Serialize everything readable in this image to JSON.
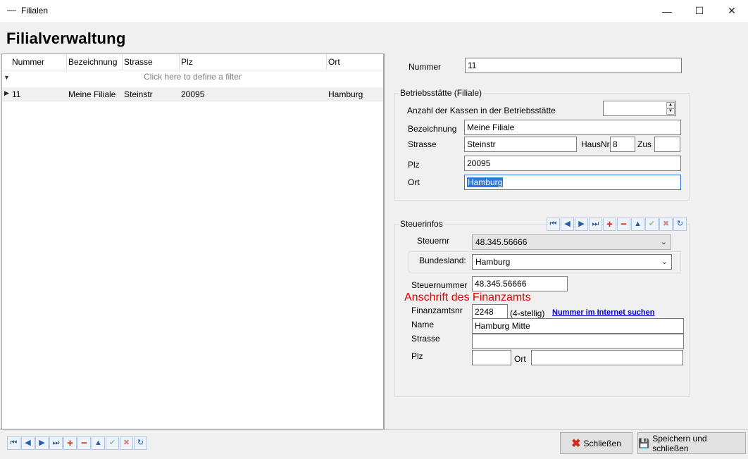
{
  "window": {
    "title": "Filialen",
    "minimize_glyph": "—",
    "maximize_glyph": "☐",
    "close_glyph": "✕"
  },
  "page_title": "Filialverwaltung",
  "grid": {
    "columns": [
      "Nummer",
      "Bezeichnung",
      "Strasse",
      "Plz",
      "Ort"
    ],
    "filter_hint": "Click here to define a filter",
    "rows": [
      {
        "nummer": "11",
        "bezeichnung": "Meine Filiale",
        "strasse": "Steinstr",
        "plz": "20095",
        "ort": "Hamburg"
      }
    ]
  },
  "form": {
    "nummer_label": "Nummer",
    "nummer_value": "11",
    "betrieb": {
      "group_title": "Betriebsstätte (Filiale)",
      "kassen_label": "Anzahl der Kassen in der Betriebsstätte",
      "kassen_value": "",
      "bezeichnung_label": "Bezeichnung",
      "bezeichnung_value": "Meine Filiale",
      "strasse_label": "Strasse",
      "strasse_value": "Steinstr",
      "hausnr_label": "HausNr",
      "hausnr_value": "8",
      "zus_label": "Zus",
      "zus_value": "",
      "plz_label": "Plz",
      "plz_value": "20095",
      "ort_label": "Ort",
      "ort_value": "Hamburg"
    },
    "steuer": {
      "group_title": "Steuerinfos",
      "steuernr_label": "Steuernr",
      "steuernr_value": "48.345.56666",
      "bundesland_label": "Bundesland:",
      "bundesland_value": "Hamburg",
      "steuernummer_label": "Steuernummer",
      "steuernummer_value": "48.345.56666",
      "finanzamt_heading": "Anschrift des Finanzamts",
      "finanzamtsnr_label": "Finanzamtsnr",
      "finanzamtsnr_value": "2248",
      "vierstellig": "(4-stellig)",
      "internet_link": "Nummer im Internet suchen",
      "name_label": "Name",
      "name_value": "Hamburg Mitte",
      "fa_strasse_label": "Strasse",
      "fa_strasse_value": "",
      "fa_plz_label": "Plz",
      "fa_plz_value": "",
      "fa_ort_label": "Ort",
      "fa_ort_value": ""
    }
  },
  "navigator_icons": [
    "first-icon",
    "prev-icon",
    "next-icon",
    "last-icon",
    "add-icon",
    "remove-icon",
    "up-icon",
    "confirm-icon",
    "cancel-icon",
    "refresh-icon"
  ],
  "buttons": {
    "close_label": "Schließen",
    "save_close_label": "Speichern und schließen"
  },
  "colors": {
    "accent_red": "#e00000",
    "link_blue": "#0000dd",
    "selection": "#3078d7"
  }
}
